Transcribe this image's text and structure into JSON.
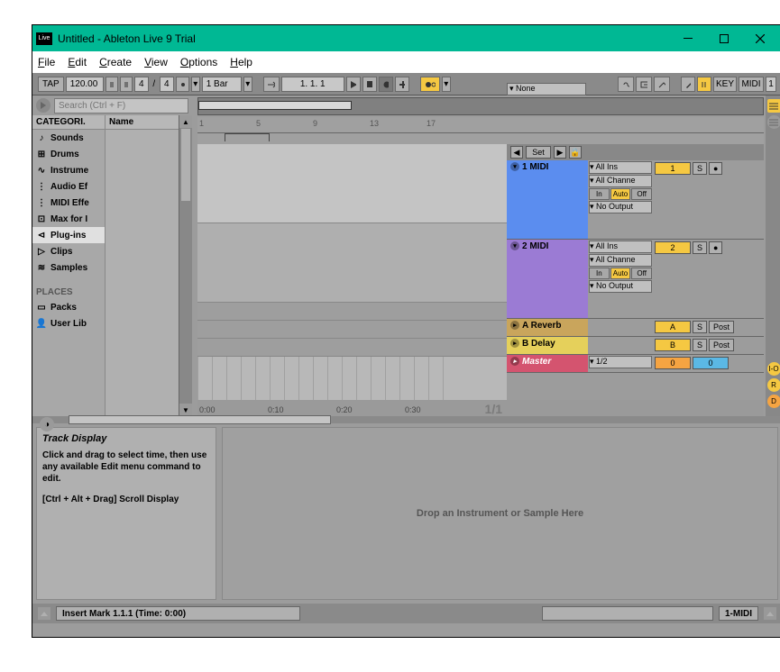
{
  "window": {
    "logo": "Live",
    "title": "Untitled - Ableton Live 9 Trial"
  },
  "menu": [
    "File",
    "Edit",
    "Create",
    "View",
    "Options",
    "Help"
  ],
  "toolbar": {
    "tap": "TAP",
    "tempo": "120.00",
    "sig_num": "4",
    "sig_den": "4",
    "bar": "1 Bar",
    "position": "1.   1.   1",
    "key": "KEY",
    "midi": "MIDI",
    "one": "1"
  },
  "search": {
    "placeholder": "Search (Ctrl + F)"
  },
  "browser": {
    "cat_header": "CATEGORI.",
    "name_header": "Name",
    "items": [
      {
        "icon": "♪",
        "label": "Sounds"
      },
      {
        "icon": "⊞",
        "label": "Drums"
      },
      {
        "icon": "∿",
        "label": "Instrume"
      },
      {
        "icon": "⋮",
        "label": "Audio Ef"
      },
      {
        "icon": "⋮",
        "label": "MIDI Effe"
      },
      {
        "icon": "⊡",
        "label": "Max for I"
      },
      {
        "icon": "⊲",
        "label": "Plug-ins"
      },
      {
        "icon": "▷",
        "label": "Clips"
      },
      {
        "icon": "≋",
        "label": "Samples"
      }
    ],
    "places_header": "PLACES",
    "places": [
      {
        "icon": "▭",
        "label": "Packs"
      },
      {
        "icon": "👤",
        "label": "User Lib"
      }
    ]
  },
  "ruler_marks": [
    "1",
    "5",
    "9",
    "13",
    "17"
  ],
  "set_bar": {
    "set": "Set"
  },
  "tracks": {
    "midi1": {
      "name": "1 MIDI",
      "in1": "All Ins",
      "in2": "All Channe",
      "none": "None",
      "io_in": "In",
      "io_auto": "Auto",
      "io_off": "Off",
      "out": "No Output",
      "num": "1",
      "s": "S",
      "rec": "●"
    },
    "midi2": {
      "name": "2 MIDI",
      "in1": "All Ins",
      "in2": "All Channe",
      "none": "None",
      "io_in": "In",
      "io_auto": "Auto",
      "io_off": "Off",
      "out": "No Output",
      "num": "2",
      "s": "S",
      "rec": "●"
    },
    "reverb": {
      "name": "A Reverb",
      "num": "A",
      "s": "S",
      "post": "Post"
    },
    "delay": {
      "name": "B Delay",
      "num": "B",
      "s": "S",
      "post": "Post"
    },
    "master": {
      "name": "Master",
      "out": "1/2",
      "zero1": "0",
      "zero2": "0"
    }
  },
  "fraction": "1/1",
  "timeline": [
    "0:00",
    "0:10",
    "0:20",
    "0:30"
  ],
  "help": {
    "title": "Track Display",
    "body": "Click and drag to select time, then use any available Edit menu command to edit.",
    "shortcut": "[Ctrl + Alt + Drag] Scroll Display"
  },
  "device_hint": "Drop an Instrument or Sample Here",
  "status": {
    "insert": "Insert Mark 1.1.1 (Time: 0:00)",
    "port": "1-MIDI"
  },
  "rail": {
    "io": "I-O",
    "r": "R",
    "d": "D"
  }
}
